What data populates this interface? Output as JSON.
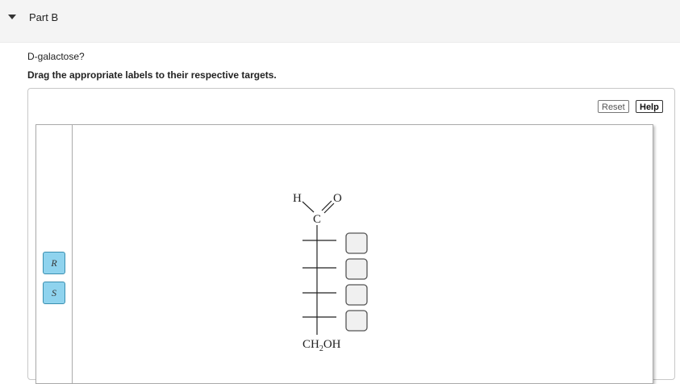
{
  "header": {
    "part_title": "Part B"
  },
  "question": {
    "text": "D-galactose?",
    "instruction": "Drag the appropriate labels to their respective targets."
  },
  "toolbar": {
    "reset_label": "Reset",
    "help_label": "Help"
  },
  "palette": {
    "labels": [
      "R",
      "S"
    ]
  },
  "molecule": {
    "top_h": "H",
    "top_o": "O",
    "carbonyl_c": "C",
    "bottom_group": "CH",
    "bottom_subscript": "2",
    "bottom_oh": "OH",
    "target_count": 4
  }
}
